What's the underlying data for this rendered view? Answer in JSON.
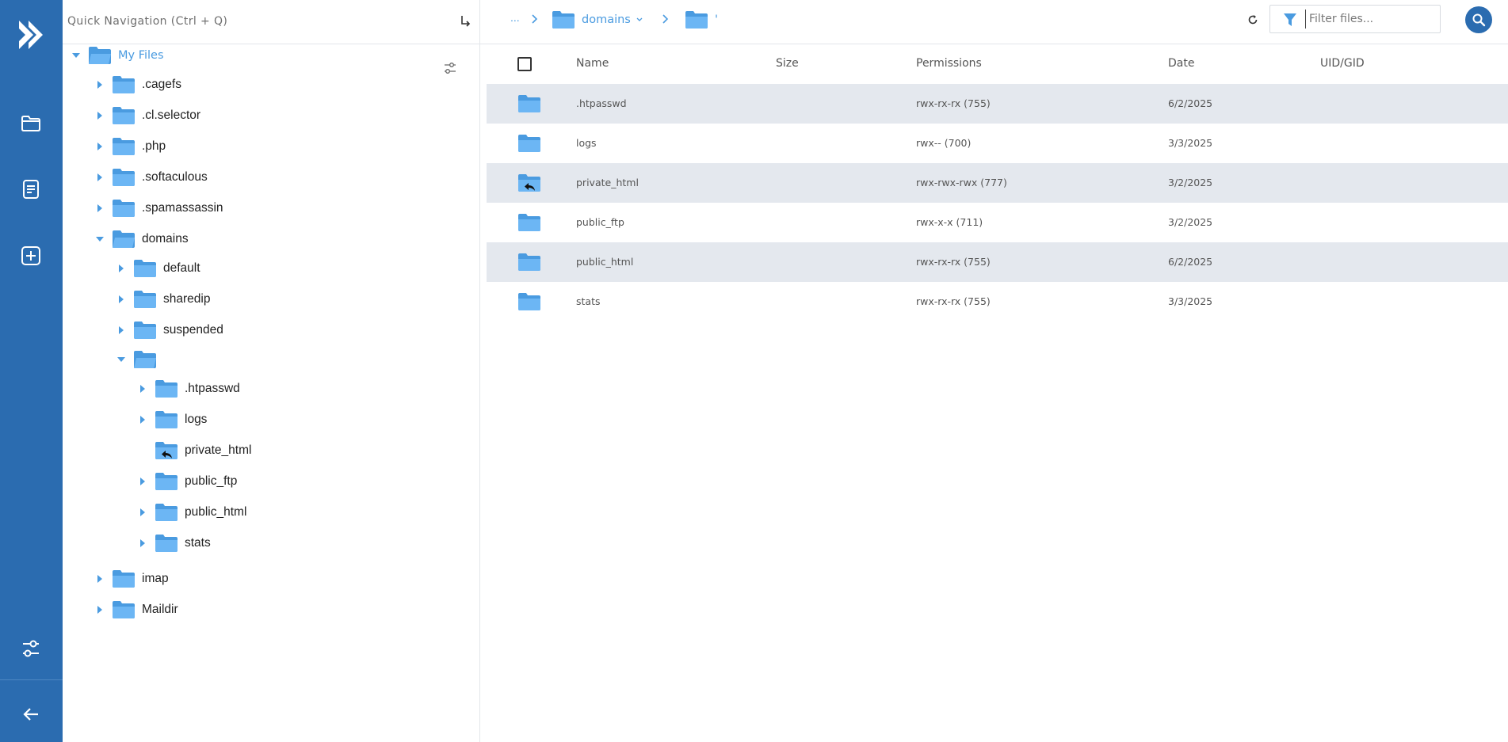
{
  "colors": {
    "accent": "#2b6cb0",
    "folder": "#6cb6f4",
    "folder_dark": "#4a9be0",
    "row_alt": "#e4e8ee"
  },
  "rail": {
    "icons": [
      "logo-icon",
      "folder-icon",
      "document-icon",
      "plus-square-icon",
      "settings-sliders-icon",
      "arrow-left-icon"
    ]
  },
  "tree": {
    "quicknav_placeholder": "Quick Navigation (Ctrl + Q)",
    "root_label": "My Files",
    "nodes": [
      {
        "label": ".cagefs"
      },
      {
        "label": ".cl.selector"
      },
      {
        "label": ".php"
      },
      {
        "label": ".softaculous"
      },
      {
        "label": ".spamassassin"
      },
      {
        "label": "domains"
      },
      {
        "label": "default"
      },
      {
        "label": "sharedip"
      },
      {
        "label": "suspended"
      },
      {
        "label": ""
      },
      {
        "label": ".htpasswd"
      },
      {
        "label": "logs"
      },
      {
        "label": "private_html"
      },
      {
        "label": "public_ftp"
      },
      {
        "label": "public_html"
      },
      {
        "label": "stats"
      },
      {
        "label": "imap"
      },
      {
        "label": "Maildir"
      }
    ]
  },
  "breadcrumb": {
    "dots": "...",
    "items": [
      {
        "label": "domains"
      },
      {
        "label": "'"
      }
    ]
  },
  "filter": {
    "placeholder": "Filter files..."
  },
  "table": {
    "headers": {
      "name": "Name",
      "size": "Size",
      "permissions": "Permissions",
      "date": "Date",
      "uid": "UID/GID"
    },
    "rows": [
      {
        "name": ".htpasswd",
        "size": "",
        "permissions": "rwx-rx-rx (755)",
        "date": "6/2/2025",
        "uid": ""
      },
      {
        "name": "logs",
        "size": "",
        "permissions": "rwx-- (700)",
        "date": "3/3/2025",
        "uid": ""
      },
      {
        "name": "private_html",
        "size": "",
        "permissions": "rwx-rwx-rwx (777)",
        "date": "3/2/2025",
        "uid": ""
      },
      {
        "name": "public_ftp",
        "size": "",
        "permissions": "rwx-x-x (711)",
        "date": "3/2/2025",
        "uid": ""
      },
      {
        "name": "public_html",
        "size": "",
        "permissions": "rwx-rx-rx (755)",
        "date": "6/2/2025",
        "uid": ""
      },
      {
        "name": "stats",
        "size": "",
        "permissions": "rwx-rx-rx (755)",
        "date": "3/3/2025",
        "uid": ""
      }
    ]
  }
}
